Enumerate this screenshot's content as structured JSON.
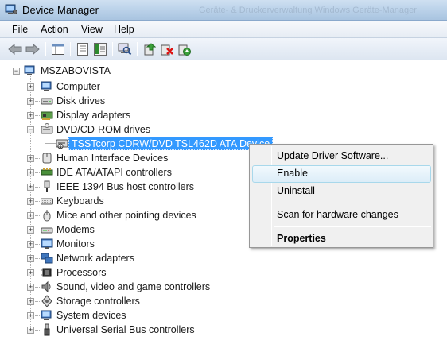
{
  "window": {
    "title": "Device Manager",
    "faded_title_text": "Geräte- & Druckerverwaltung     Windows     Geräte-Manager"
  },
  "menubar": {
    "items": [
      "File",
      "Action",
      "View",
      "Help"
    ]
  },
  "toolbar": {
    "buttons": [
      "back-icon",
      "forward-icon",
      "show-hide-console-tree-icon",
      "properties-icon",
      "help-icon",
      "scan-hardware-icon",
      "update-driver-icon",
      "disable-device-icon",
      "uninstall-icon",
      "enable-device-icon"
    ]
  },
  "tree": {
    "root": "MSZABOVISTA",
    "categories": [
      "Computer",
      "Disk drives",
      "Display adapters",
      "DVD/CD-ROM drives",
      "Human Interface Devices",
      "IDE ATA/ATAPI controllers",
      "IEEE 1394 Bus host controllers",
      "Keyboards",
      "Mice and other pointing devices",
      "Modems",
      "Monitors",
      "Network adapters",
      "Processors",
      "Sound, video and game controllers",
      "Storage controllers",
      "System devices",
      "Universal Serial Bus controllers"
    ],
    "selected_device": "TSSTcorp CDRW/DVD TSL462D ATA Device"
  },
  "context_menu": {
    "update_driver": "Update Driver Software...",
    "enable": "Enable",
    "uninstall": "Uninstall",
    "scan": "Scan for hardware changes",
    "properties": "Properties"
  },
  "colors": {
    "selection": "#3399ff",
    "menu_background": "#f0f0f0",
    "hover_border": "#a8d8eb"
  }
}
